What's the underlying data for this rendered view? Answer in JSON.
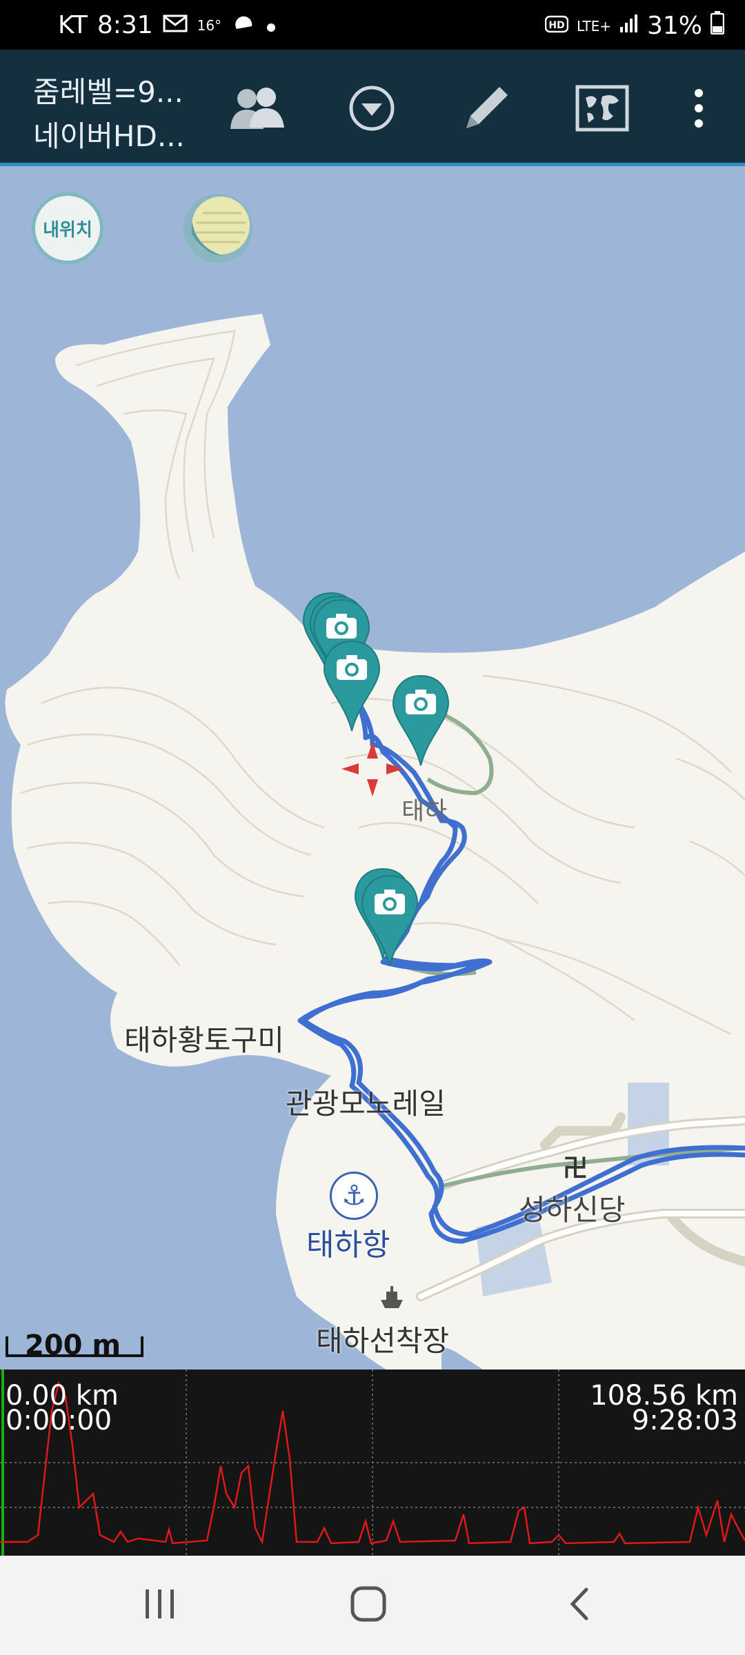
{
  "status_bar": {
    "carrier": "KT",
    "time": "8:31",
    "temp": "16°",
    "network": "LTE+",
    "battery": "31%"
  },
  "toolbar": {
    "title_line1": "줌레벨=9...",
    "title_line2": "네이버HD...",
    "icons": [
      "people-icon",
      "dropdown-icon",
      "pencil-icon",
      "map-layers-icon",
      "more-vert-icon"
    ]
  },
  "map": {
    "my_location_label": "내위치",
    "labels": {
      "taeha": "태하",
      "taeha_hwangto": "태하황토구미",
      "monorail": "관광모노레일",
      "seongha": "성하신당",
      "taeha_port": "태하항",
      "pier": "태하선착장"
    },
    "scale": "200 m",
    "track_color": "#3f6fd0",
    "marker_color": "#2a9a9e"
  },
  "elevation": {
    "start_distance": "0.00 km",
    "start_time": "0:00:00",
    "end_distance": "108.56 km",
    "end_time": "9:28:03",
    "line_color": "#e01818"
  },
  "nav": {
    "icons": [
      "recent-apps-icon",
      "home-icon",
      "back-icon"
    ]
  }
}
